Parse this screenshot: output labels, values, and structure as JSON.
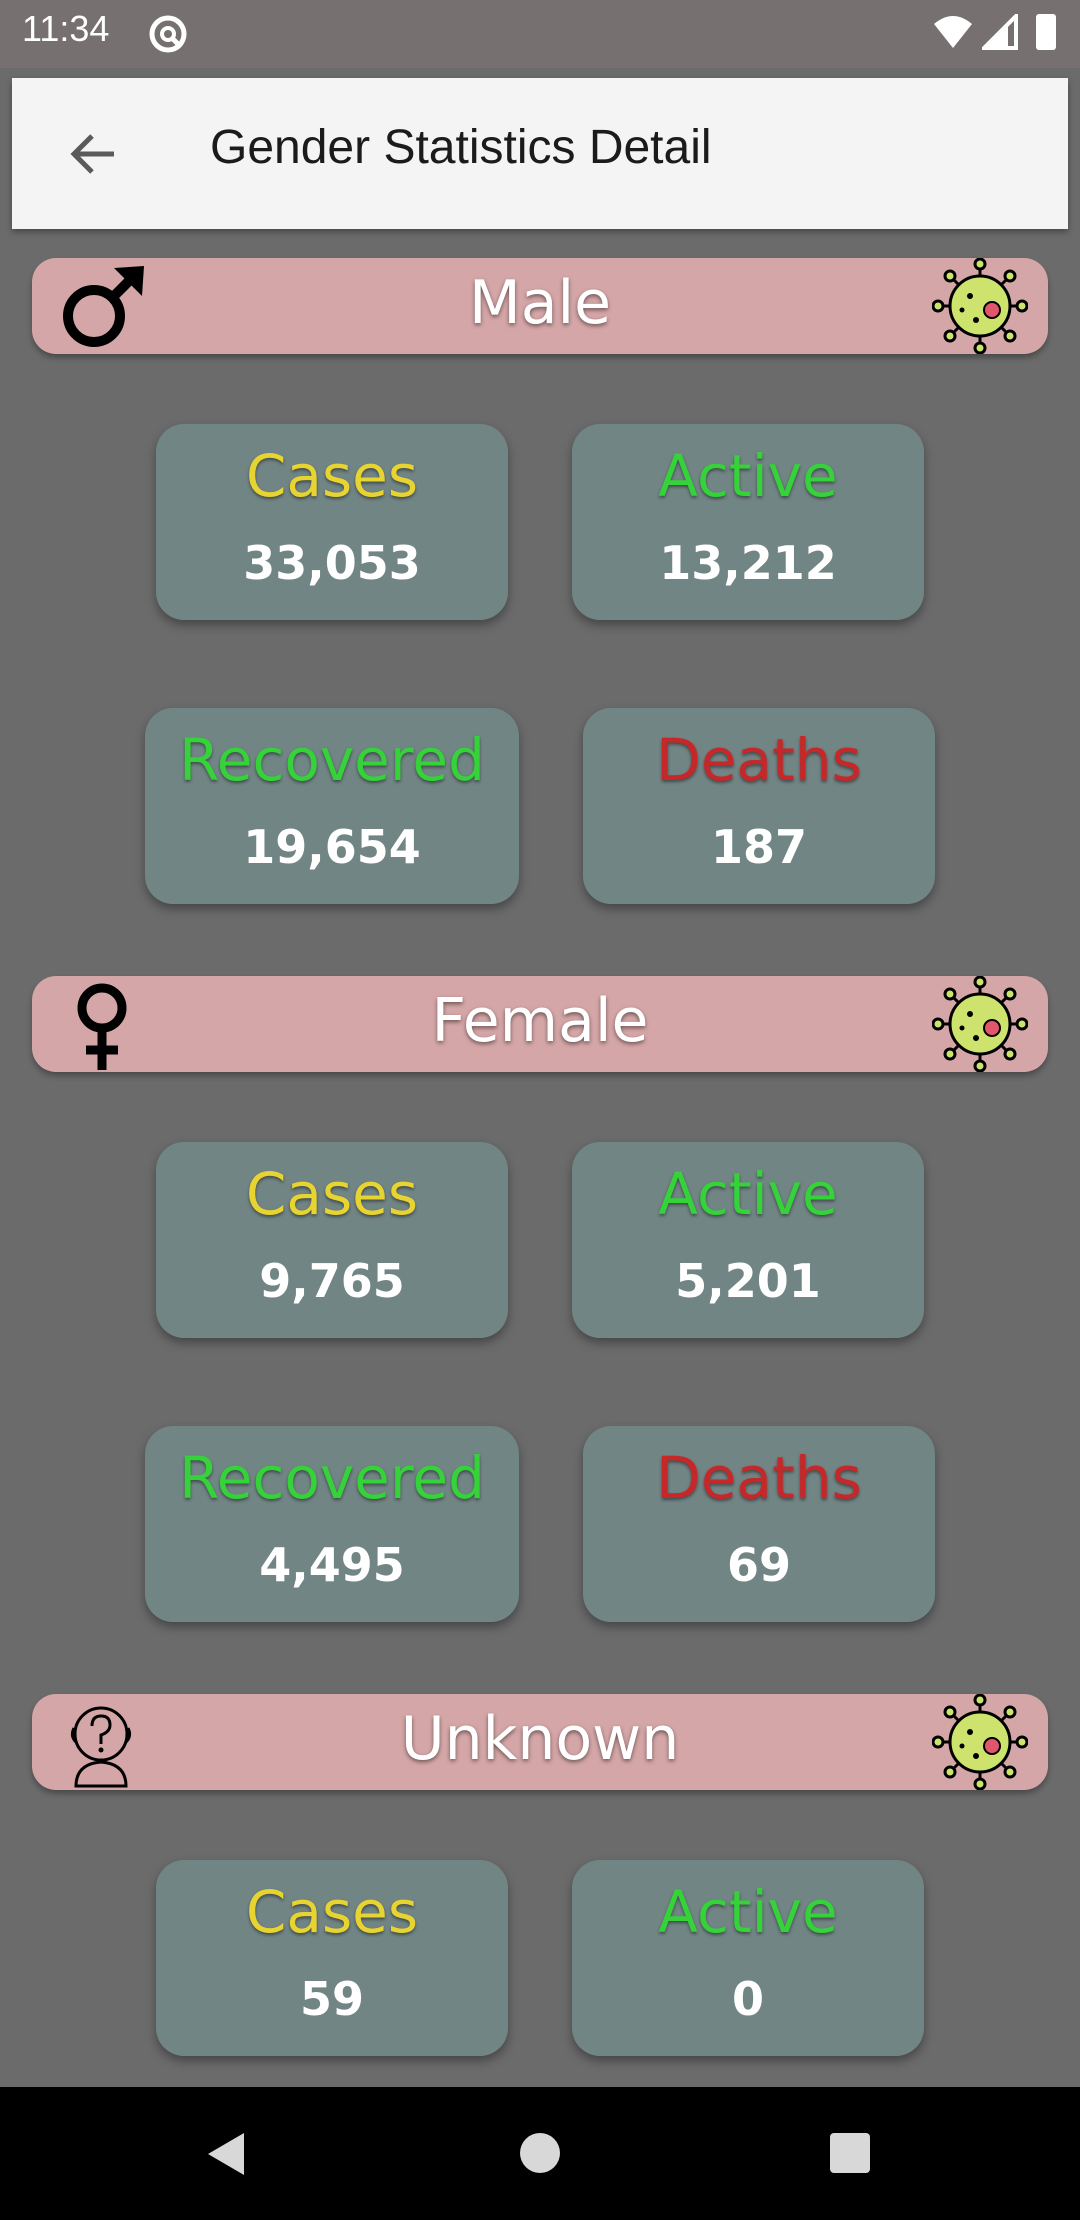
{
  "status_bar": {
    "time": "11:34"
  },
  "app_bar": {
    "title": "Gender Statistics Detail"
  },
  "colors": {
    "cases": "#e8d431",
    "active": "#35d23a",
    "recovered": "#35d23a",
    "deaths": "#c6282a",
    "header_bg": "#d5a6a7",
    "card_bg": "#728585"
  },
  "sections": [
    {
      "label": "Male",
      "icon": "male-symbol-icon",
      "cards": [
        {
          "label": "Cases",
          "value": "33,053"
        },
        {
          "label": "Active",
          "value": "13,212"
        },
        {
          "label": "Recovered",
          "value": "19,654"
        },
        {
          "label": "Deaths",
          "value": "187"
        }
      ]
    },
    {
      "label": "Female",
      "icon": "female-symbol-icon",
      "cards": [
        {
          "label": "Cases",
          "value": "9,765"
        },
        {
          "label": "Active",
          "value": "5,201"
        },
        {
          "label": "Recovered",
          "value": "4,495"
        },
        {
          "label": "Deaths",
          "value": "69"
        }
      ]
    },
    {
      "label": "Unknown",
      "icon": "unknown-person-icon",
      "cards": [
        {
          "label": "Cases",
          "value": "59"
        },
        {
          "label": "Active",
          "value": "0"
        }
      ]
    }
  ]
}
